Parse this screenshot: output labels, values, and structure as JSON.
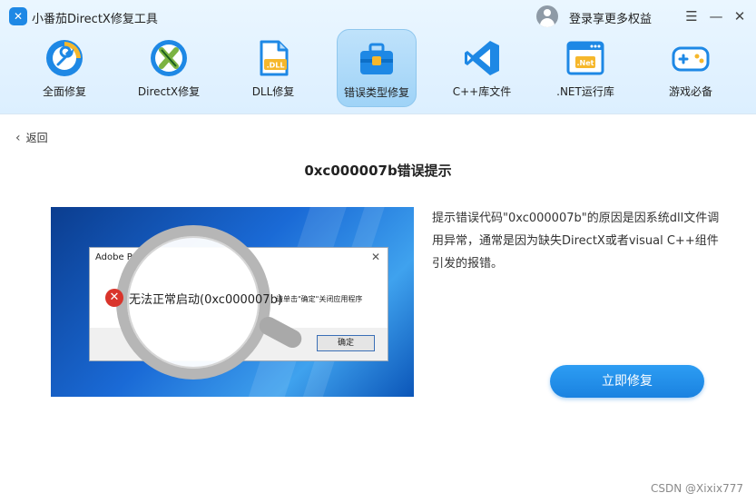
{
  "app": {
    "title": "小番茄DirectX修复工具",
    "logo_glyph": "✕",
    "login_text": "登录享更多权益"
  },
  "window_controls": {
    "menu": "☰",
    "minimize": "—",
    "close": "✕"
  },
  "nav": {
    "items": [
      {
        "label": "全面修复",
        "icon": "wrench-icon",
        "active": false
      },
      {
        "label": "DirectX修复",
        "icon": "directx-icon",
        "active": false
      },
      {
        "label": "DLL修复",
        "icon": "dll-file-icon",
        "active": false
      },
      {
        "label": "错误类型修复",
        "icon": "toolbox-icon",
        "active": true
      },
      {
        "label": "C++库文件",
        "icon": "visual-studio-icon",
        "active": false
      },
      {
        "label": ".NET运行库",
        "icon": "dotnet-window-icon",
        "active": false
      },
      {
        "label": "游戏必备",
        "icon": "gamepad-icon",
        "active": false
      }
    ],
    "accent_color": "#1e88e5"
  },
  "main": {
    "back_label": "返回",
    "page_title": "0xc000007b错误提示",
    "description": "提示错误代码\"0xc000007b\"的原因是因系统dll文件调用异常，通常是因为缺失DirectX或者visual C++组件引发的报错。",
    "repair_button": "立即修复"
  },
  "screenshot": {
    "dialog_title": "Adobe Pr",
    "error_text": "无法正常启动(0xc000007b)",
    "message_suffix": "请单击\"确定\"关闭应用程序",
    "ok_button": "确定"
  },
  "watermark": "CSDN @Xixix777"
}
